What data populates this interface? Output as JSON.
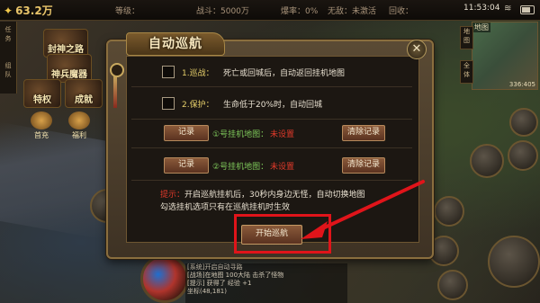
{
  "status_bar": {
    "gold": "63.2万",
    "gold_icon": "coin-icon",
    "level_label": "等级：",
    "exp_label": "战斗：5000万",
    "rate_label": "爆率：0%",
    "free_label": "无敌：未激活",
    "recycle_label": "回收：",
    "time": "11:53:04"
  },
  "left_tabs": [
    "任",
    "务",
    "组",
    "队"
  ],
  "menu_icons": [
    {
      "label": "封神之路"
    },
    {
      "label": "神兵魔器"
    },
    {
      "label": "特权"
    },
    {
      "label": "成就"
    }
  ],
  "side_icons": [
    {
      "label": "首充"
    },
    {
      "label": "福利"
    }
  ],
  "minimap": {
    "title": "地图",
    "tabs": [
      "地图",
      "全体"
    ],
    "coords": "336:405"
  },
  "dialog": {
    "title": "自动巡航",
    "close_icon": "close-icon",
    "options": [
      {
        "num": "1.",
        "name": "巡战：",
        "text": "死亡或回城后，自动返回挂机地图"
      },
      {
        "num": "2.",
        "name": "保护：",
        "text": "生命低于20%时，自动回城"
      }
    ],
    "map_rows": [
      {
        "record_label": "记录",
        "map_label": "①号挂机地图：",
        "map_value": "未设置",
        "clear_label": "清除记录"
      },
      {
        "record_label": "记录",
        "map_label": "②号挂机地图：",
        "map_value": "未设置",
        "clear_label": "清除记录"
      }
    ],
    "hint_prefix": "提示：",
    "hint_line1": "开启巡航挂机后，30秒内身边无怪，自动切换地图",
    "hint_line2": "勾选挂机选项只有在巡航挂机时生效",
    "start_label": "开始巡航"
  },
  "chat": {
    "lines": [
      "[系统]开启自动寻路",
      "[战场]在地图 100大陆 击杀了怪物",
      "[提示] 获得了 经验 +1",
      "坐标(48,181)"
    ]
  },
  "colors": {
    "highlight": "#e0141a",
    "map_unset": "#e03a2a",
    "map_label": "#7ec85a"
  }
}
